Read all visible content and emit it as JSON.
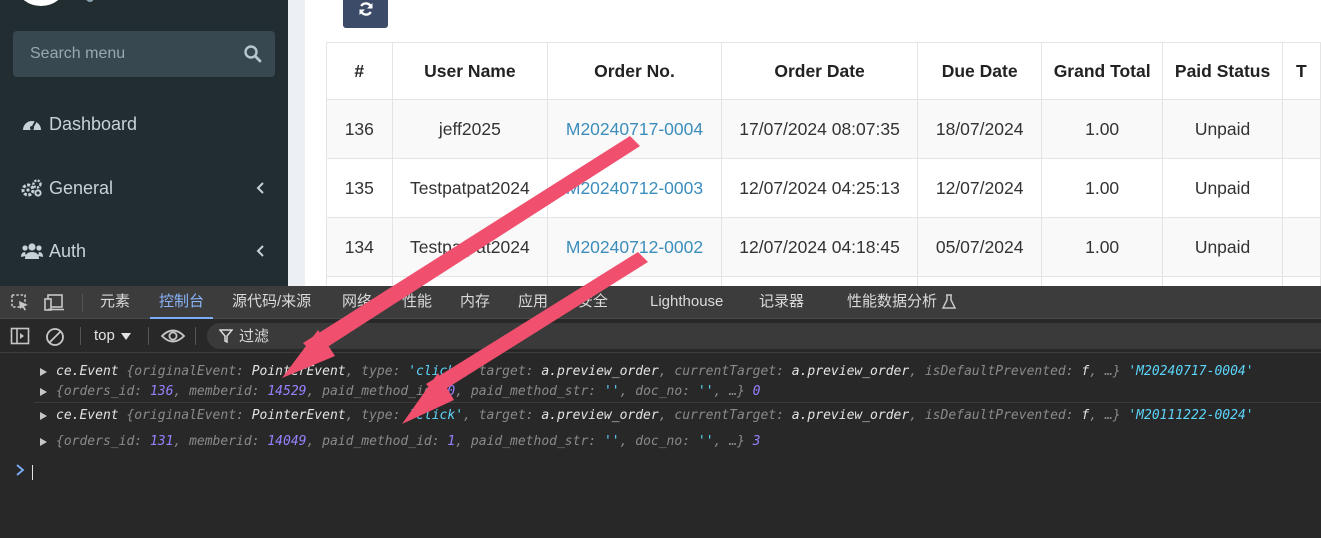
{
  "sidebar": {
    "search_placeholder": "Search menu",
    "items": [
      {
        "label": "Dashboard",
        "icon": "tachometer-icon"
      },
      {
        "label": "General",
        "icon": "cogs-icon"
      },
      {
        "label": "Auth",
        "icon": "users-icon"
      }
    ]
  },
  "table": {
    "headers": [
      "#",
      "User Name",
      "Order No.",
      "Order Date",
      "Due Date",
      "Grand Total",
      "Paid Status",
      "T"
    ],
    "rows": [
      {
        "id": "136",
        "user": "jeff2025",
        "order_no": "M20240717-0004",
        "order_date": "17/07/2024 08:07:35",
        "due_date": "18/07/2024",
        "total": "1.00",
        "status": "Unpaid"
      },
      {
        "id": "135",
        "user": "Testpatpat2024",
        "order_no": "M20240712-0003",
        "order_date": "12/07/2024 04:25:13",
        "due_date": "12/07/2024",
        "total": "1.00",
        "status": "Unpaid"
      },
      {
        "id": "134",
        "user": "Testpatpat2024",
        "order_no": "M20240712-0002",
        "order_date": "12/07/2024 04:18:45",
        "due_date": "05/07/2024",
        "total": "1.00",
        "status": "Unpaid"
      }
    ]
  },
  "devtools": {
    "tabs": [
      "元素",
      "控制台",
      "源代码/来源",
      "网络",
      "性能",
      "内存",
      "应用",
      "安全",
      "Lighthouse",
      "记录器",
      "性能数据分析"
    ],
    "active_tab": "控制台",
    "context": "top",
    "filter_placeholder": "过滤",
    "messages": [
      {
        "event": {
          "prefix": "ce.Event",
          "k1": "originalEvent",
          "v1": "PointerEvent",
          "k2": "type",
          "v2": "'click'",
          "k3": "target",
          "v3": "a.preview_order",
          "k4": "currentTarget",
          "v4": "a.preview_order",
          "k5": "isDefaultPrevented",
          "v5": "f",
          "ellipsis": "…}",
          "extra": "'M20240717-0004'"
        },
        "obj": {
          "k1": "orders_id",
          "v1": "136",
          "k2": "memberid",
          "v2": "14529",
          "k3": "paid_method_id",
          "v3": "0",
          "k4": "paid_method_str",
          "v4": "''",
          "k5": "doc_no",
          "v5": "''",
          "ellipsis": "…}",
          "extra": "0"
        }
      },
      {
        "event": {
          "prefix": "ce.Event",
          "k1": "originalEvent",
          "v1": "PointerEvent",
          "k2": "type",
          "v2": "'click'",
          "k3": "target",
          "v3": "a.preview_order",
          "k4": "currentTarget",
          "v4": "a.preview_order",
          "k5": "isDefaultPrevented",
          "v5": "f",
          "ellipsis": "…}",
          "extra": "'M20111222-0024'"
        },
        "obj": {
          "k1": "orders_id",
          "v1": "131",
          "k2": "memberid",
          "v2": "14049",
          "k3": "paid_method_id",
          "v3": "1",
          "k4": "paid_method_str",
          "v4": "''",
          "k5": "doc_no",
          "v5": "''",
          "ellipsis": "…}",
          "extra": "3"
        }
      }
    ]
  },
  "colors": {
    "sidebar_bg": "#222d32",
    "link": "#3c8dbc",
    "devtools_bg": "#282828",
    "annotation_arrow": "#f0506e"
  }
}
